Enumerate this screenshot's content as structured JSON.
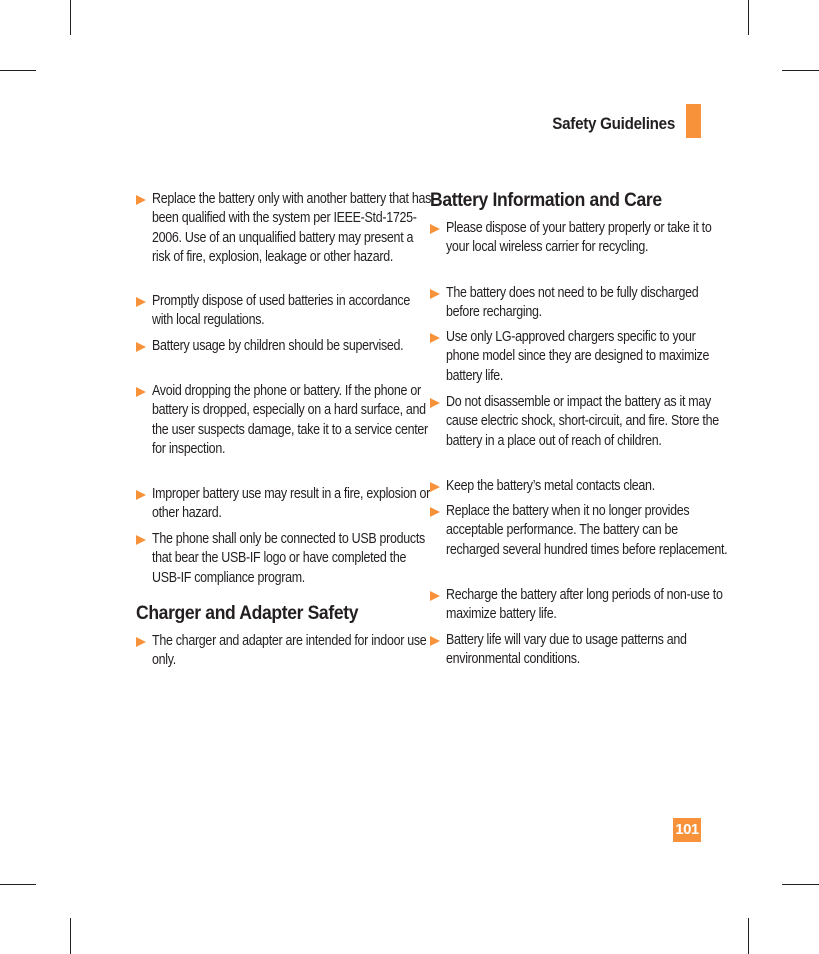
{
  "header": {
    "section_title": "Safety Guidelines",
    "accent_color": "#f7923a"
  },
  "left_column": {
    "bullets": [
      "Replace the battery only with another battery that has been qualified with the system per IEEE-Std-1725-2006. Use of an unqualified battery may present a risk of fire, explosion, leakage or other hazard.",
      "Promptly dispose of used batteries in accordance with local regulations.",
      "Battery usage by children should be supervised.",
      "Avoid dropping the phone or battery. If the phone or battery is dropped, especially on a hard surface, and the user suspects damage, take it to a service center for inspection.",
      "Improper battery use may result in a fire, explosion or other hazard.",
      "The phone shall only be connected to USB products that bear the USB-IF logo or have completed the USB-IF compliance program."
    ],
    "charger_section": {
      "heading": "Charger and Adapter Safety",
      "bullets": [
        "The charger and adapter are intended for indoor use only."
      ]
    }
  },
  "right_column": {
    "battery_section": {
      "heading": "Battery Information and Care",
      "bullets": [
        "Please dispose of your battery properly or take it to your local wireless carrier for recycling.",
        "The battery does not need to be fully discharged before recharging.",
        "Use only LG-approved chargers specific to your phone model since they are designed to maximize battery life.",
        "Do not disassemble or impact the battery as it may cause electric shock, short-circuit, and fire. Store the battery in a place out of reach of children.",
        "Keep the battery’s metal contacts clean.",
        "Replace the battery when it no longer provides acceptable performance. The battery can be recharged several hundred times before replacement.",
        "Recharge the battery after long periods of non-use to maximize battery life.",
        "Battery life will vary due to usage patterns and environmental conditions."
      ]
    }
  },
  "footer": {
    "page_number": "101"
  }
}
